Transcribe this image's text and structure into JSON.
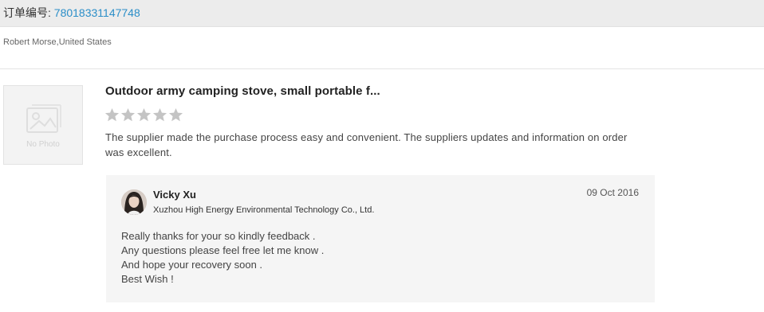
{
  "order": {
    "label": "订单编号:",
    "number": "78018331147748"
  },
  "buyer": {
    "name_country": "Robert Morse,United States"
  },
  "product": {
    "image_placeholder": "No Photo",
    "title": "Outdoor army camping stove, small portable f...",
    "rating": 5,
    "review": "The supplier made the purchase process easy and  convenient. The suppliers  updates and information on order was excellent."
  },
  "reply": {
    "name": "Vicky Xu",
    "date": "09 Oct 2016",
    "company": "Xuzhou High Energy Environmental Technology Co., Ltd.",
    "lines": [
      "Really thanks for your so kindly feedback .",
      "Any questions please feel free let me know .",
      "And hope your recovery soon .",
      "Best Wish !"
    ]
  },
  "colors": {
    "star": "#c4c4c4",
    "order_number": "#2b8ec8",
    "reply_background": "#f5f5f5"
  }
}
